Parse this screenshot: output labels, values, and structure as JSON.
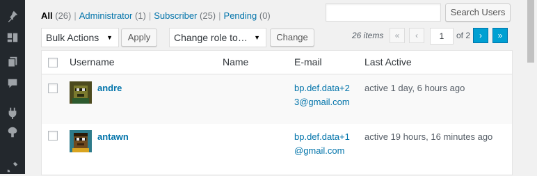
{
  "filters": {
    "all": {
      "label": "All",
      "count": "(26)"
    },
    "administrator": {
      "label": "Administrator",
      "count": "(1)"
    },
    "subscriber": {
      "label": "Subscriber",
      "count": "(25)"
    },
    "pending": {
      "label": "Pending",
      "count": "(0)"
    },
    "separator": "|"
  },
  "search": {
    "placeholder": "",
    "button": "Search Users"
  },
  "actions": {
    "bulk": "Bulk Actions",
    "apply": "Apply",
    "role": "Change role to…",
    "change": "Change"
  },
  "pagination": {
    "items": "26 items",
    "first": "«",
    "prev": "‹",
    "current": "1",
    "of": "of 2",
    "next": "›",
    "last": "»"
  },
  "table": {
    "columns": {
      "username": "Username",
      "name": "Name",
      "email": "E-mail",
      "last_active": "Last Active"
    },
    "rows": [
      {
        "username": "andre",
        "name": "",
        "email": "bp.def.data+23@gmail.com",
        "last_active": "active 1 day, 6 hours ago"
      },
      {
        "username": "antawn",
        "name": "",
        "email": "bp.def.data+1@gmail.com",
        "last_active": "active 19 hours, 16 minutes ago"
      }
    ]
  },
  "sidebar_icons": [
    "pin-icon",
    "media-icon",
    "pages-icon",
    "comments-icon",
    "plugins-icon",
    "appearance-icon",
    "tools-icon"
  ],
  "colors": {
    "link": "#0073aa",
    "sidebar": "#23282d",
    "accent": "#00a0d2"
  }
}
